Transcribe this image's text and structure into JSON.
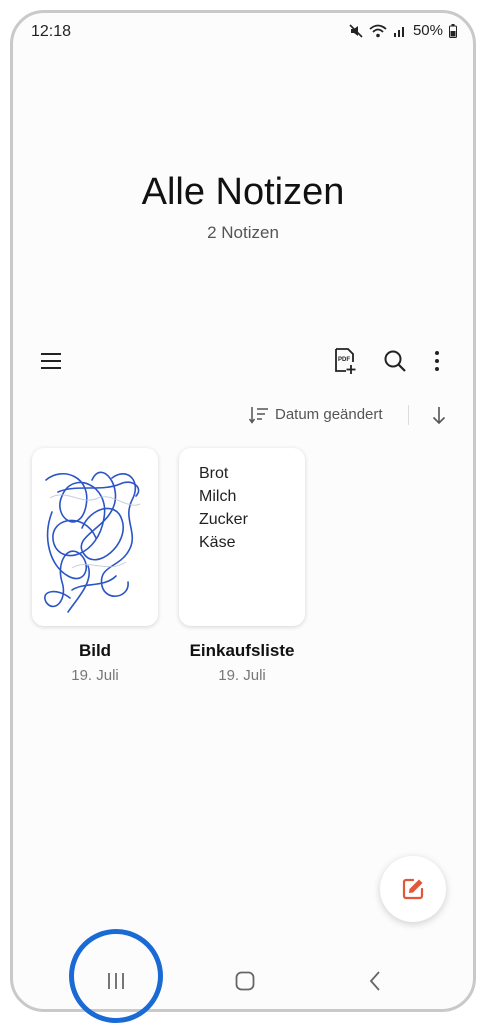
{
  "status": {
    "time": "12:18",
    "battery": "50%"
  },
  "header": {
    "title": "Alle Notizen",
    "count": "2 Notizen"
  },
  "toolbar": {
    "menu_icon": "hamburger-menu-icon",
    "pdf_icon": "pdf-add-icon",
    "search_icon": "search-icon",
    "more_icon": "more-vertical-icon"
  },
  "sort": {
    "label": "Datum geändert",
    "direction_icon": "arrow-down-icon"
  },
  "notes": [
    {
      "title": "Bild",
      "date": "19. Juli",
      "type": "drawing",
      "stroke_color": "#2b55c7"
    },
    {
      "title": "Einkaufsliste",
      "date": "19. Juli",
      "type": "text",
      "lines": [
        "Brot",
        "Milch",
        "Zucker",
        "Käse"
      ]
    }
  ],
  "fab": {
    "icon": "compose-note-icon",
    "color": "#e0573a"
  },
  "navbar": {
    "recents_icon": "recents-icon",
    "home_icon": "home-icon",
    "back_icon": "back-icon"
  },
  "highlight_color": "#1a6ad6"
}
